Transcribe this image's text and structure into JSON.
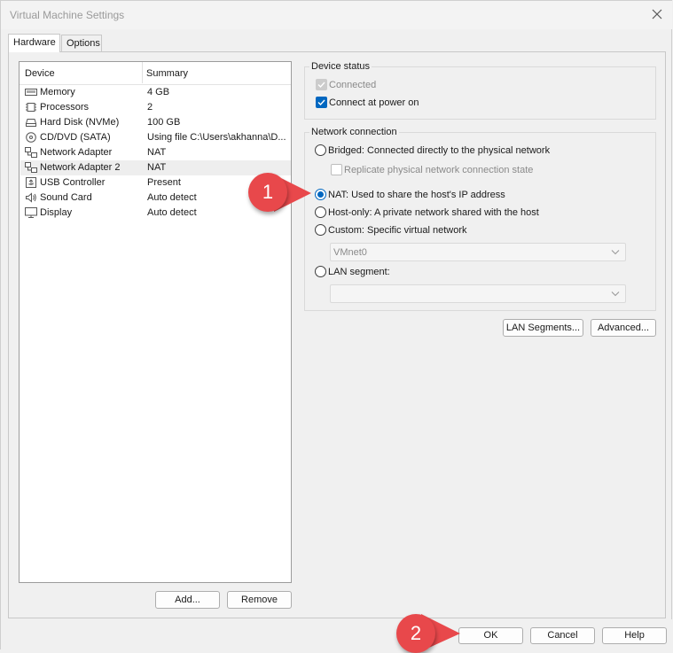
{
  "window": {
    "title": "Virtual Machine Settings"
  },
  "tabs": [
    {
      "label": "Hardware",
      "active": true
    },
    {
      "label": "Options",
      "active": false
    }
  ],
  "device_list": {
    "columns": [
      "Device",
      "Summary"
    ],
    "rows": [
      {
        "icon": "memory-icon",
        "device": "Memory",
        "summary": "4 GB"
      },
      {
        "icon": "processor-icon",
        "device": "Processors",
        "summary": "2"
      },
      {
        "icon": "hard-disk-icon",
        "device": "Hard Disk (NVMe)",
        "summary": "100 GB"
      },
      {
        "icon": "cd-dvd-icon",
        "device": "CD/DVD (SATA)",
        "summary": "Using file C:\\Users\\akhanna\\D..."
      },
      {
        "icon": "network-adapter-icon",
        "device": "Network Adapter",
        "summary": "NAT"
      },
      {
        "icon": "network-adapter-icon",
        "device": "Network Adapter 2",
        "summary": "NAT",
        "selected": true
      },
      {
        "icon": "usb-icon",
        "device": "USB Controller",
        "summary": "Present"
      },
      {
        "icon": "speaker-icon",
        "device": "Sound Card",
        "summary": "Auto detect"
      },
      {
        "icon": "monitor-icon",
        "device": "Display",
        "summary": "Auto detect"
      }
    ]
  },
  "list_buttons": {
    "add": "Add...",
    "remove": "Remove"
  },
  "device_status": {
    "title": "Device status",
    "connected": {
      "label": "Connected",
      "checked": true,
      "enabled": false
    },
    "connect_at_power_on": {
      "label": "Connect at power on",
      "checked": true
    }
  },
  "network_connection": {
    "title": "Network connection",
    "bridged": {
      "label": "Bridged: Connected directly to the physical network",
      "checked": false
    },
    "replicate": {
      "label": "Replicate physical network connection state",
      "checked": false,
      "enabled": false
    },
    "nat": {
      "label": "NAT: Used to share the host's IP address",
      "checked": true
    },
    "host_only": {
      "label": "Host-only: A private network shared with the host",
      "checked": false
    },
    "custom": {
      "label": "Custom: Specific virtual network",
      "checked": false
    },
    "custom_select_value": "VMnet0",
    "lan_segment": {
      "label": "LAN segment:",
      "checked": false
    },
    "lan_select_value": ""
  },
  "network_buttons": {
    "lan_segments": "LAN Segments...",
    "advanced": "Advanced..."
  },
  "dialog_buttons": {
    "ok": "OK",
    "cancel": "Cancel",
    "help": "Help"
  },
  "annotations": {
    "step1": "1",
    "step2": "2",
    "badge_color": "#e8484b"
  },
  "colors": {
    "accent": "#0067c0"
  }
}
